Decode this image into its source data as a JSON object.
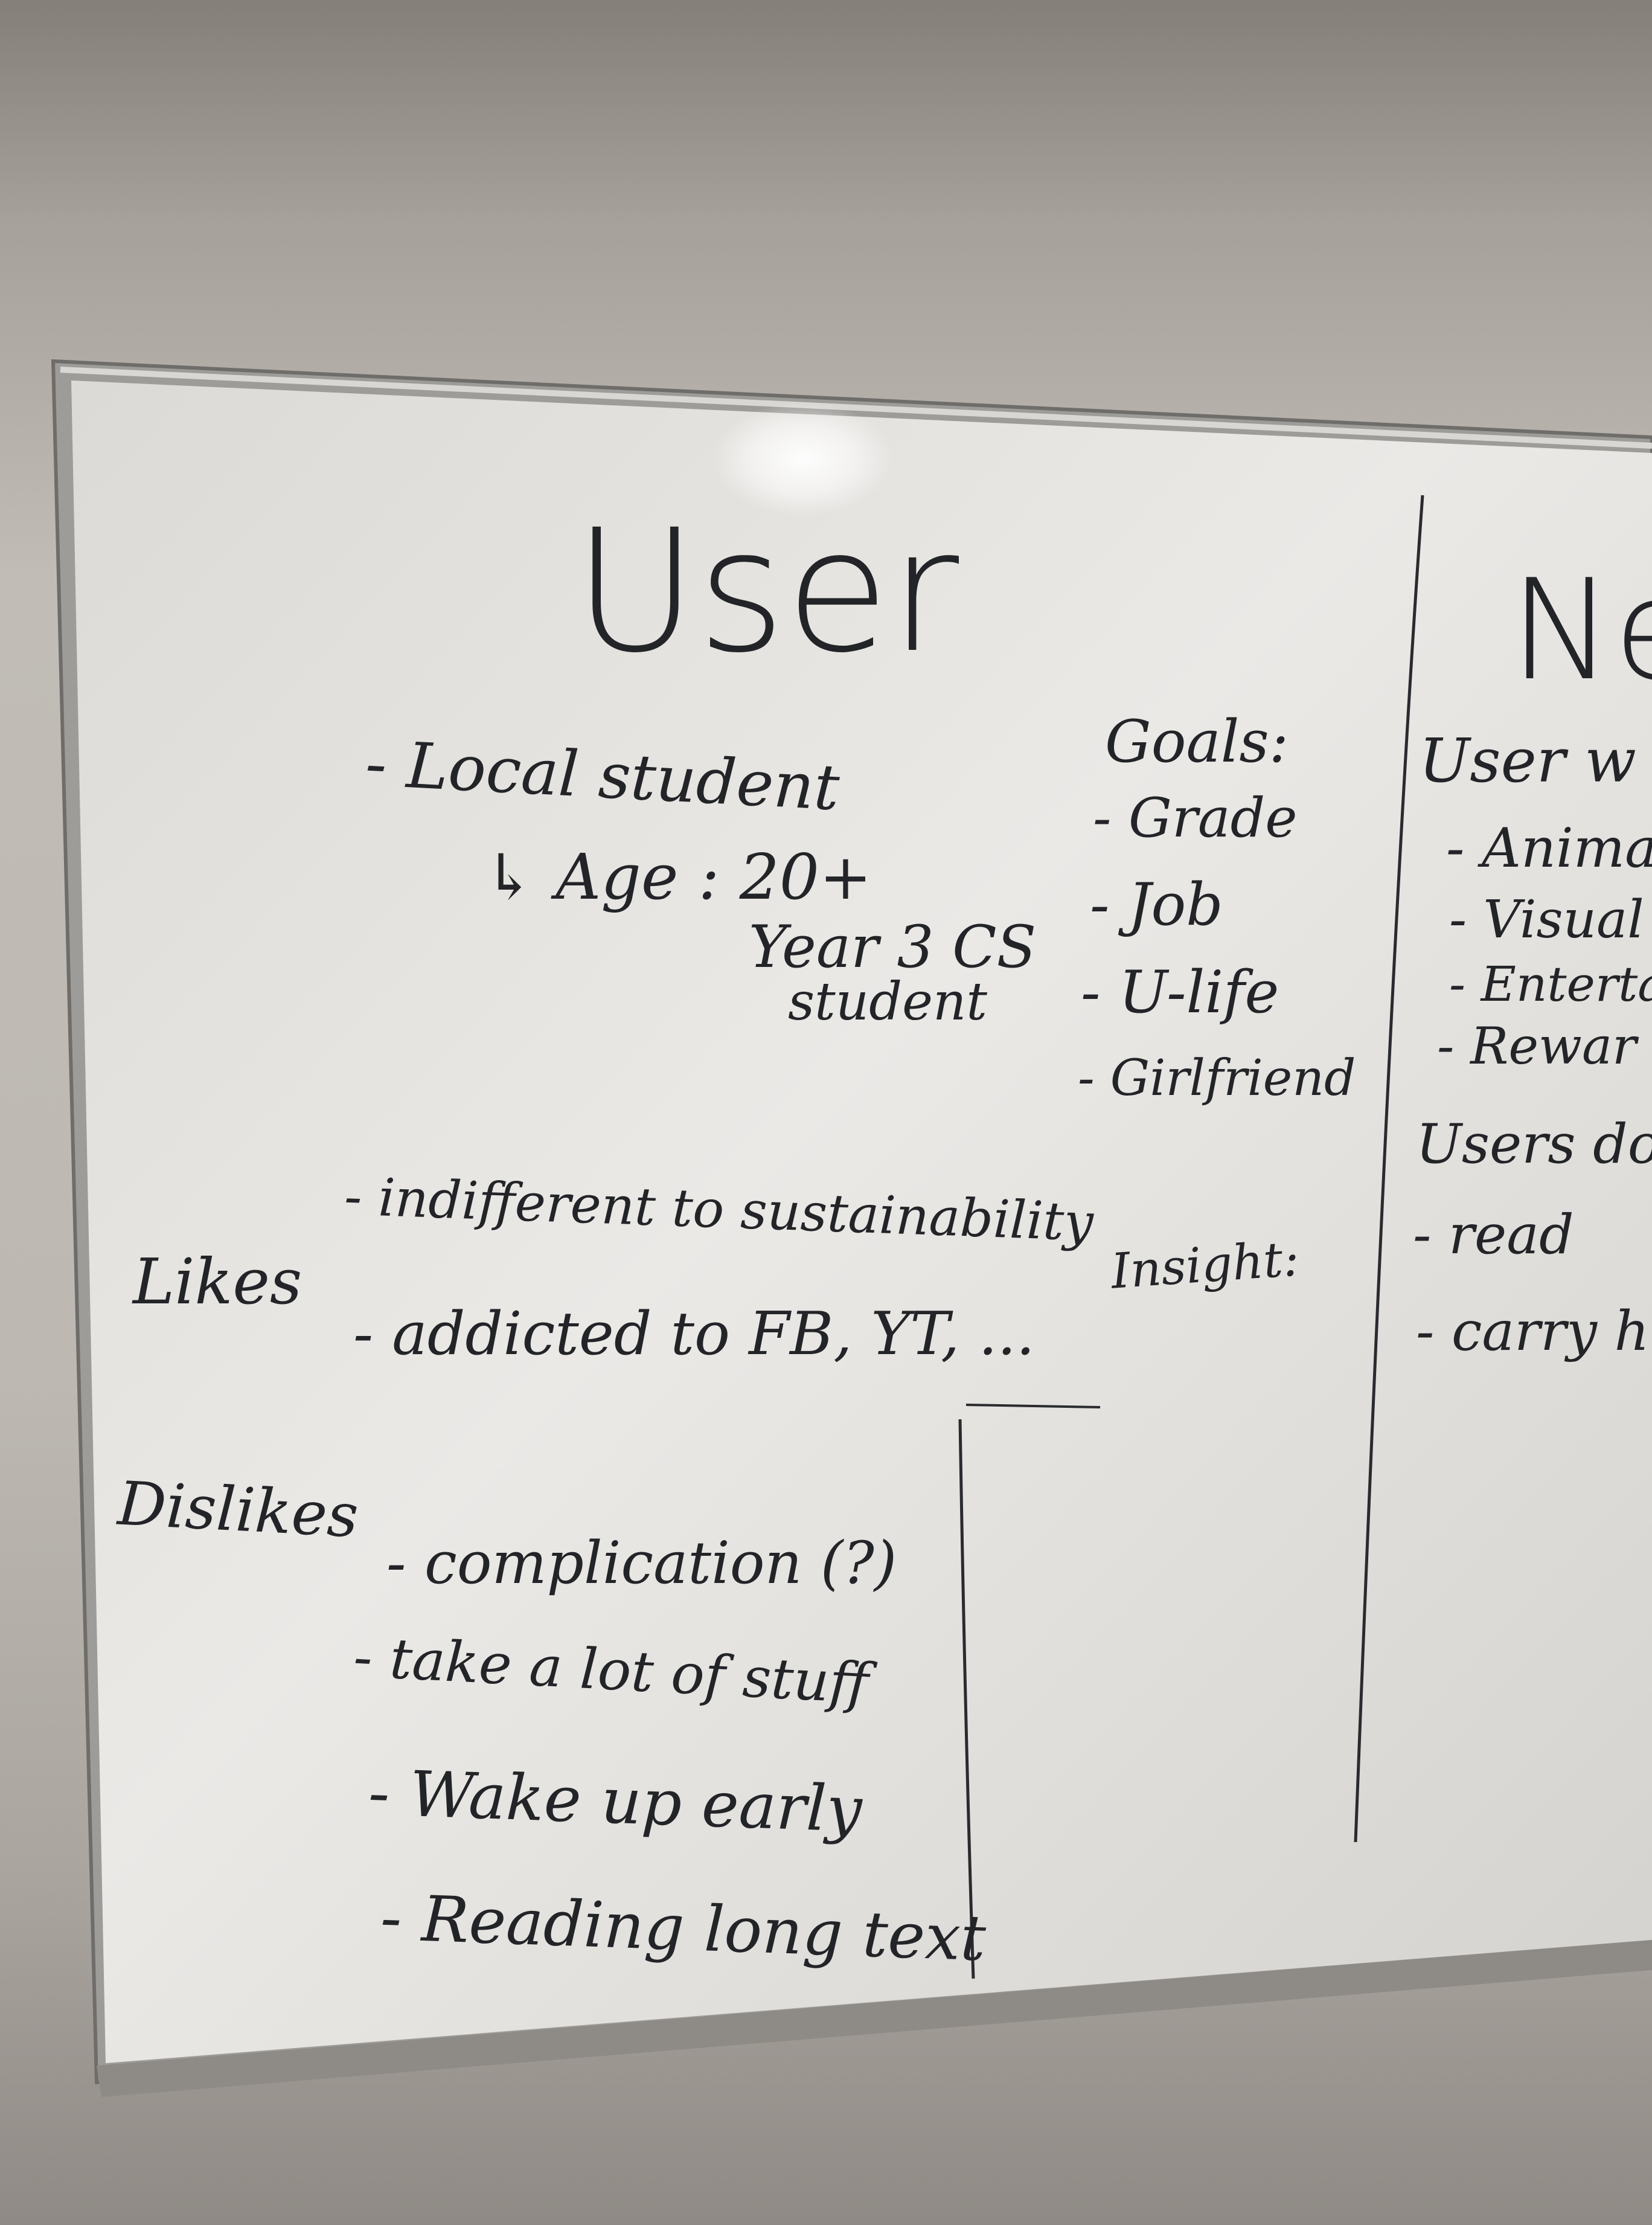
{
  "board": {
    "left_panel": {
      "title": "User",
      "profile": {
        "items": [
          "- Local student",
          "↳ Age : 20+",
          "Year 3 CS",
          "student"
        ]
      },
      "goals": {
        "heading": "Goals:",
        "items": [
          "- Grade",
          "- Job",
          "- U-life",
          "- Girlfriend"
        ]
      },
      "likes": {
        "label": "Likes",
        "items": [
          "- indifferent to sustainability",
          "- addicted to FB, YT, ..."
        ]
      },
      "insight": {
        "label": "Insight:"
      },
      "dislikes": {
        "label": "Dislikes",
        "items": [
          "- complication (?)",
          "- take a lot of stuff",
          "- Wake up early",
          "- Reading long text"
        ]
      }
    },
    "right_panel": {
      "title_partial": "Ne",
      "users_want": {
        "heading": "User w",
        "items": [
          "- Anima",
          "- Visual",
          "- Entertai",
          "- Rewar"
        ]
      },
      "users_do": {
        "heading": "Users do",
        "items": [
          "- read",
          "- carry h"
        ]
      }
    }
  }
}
